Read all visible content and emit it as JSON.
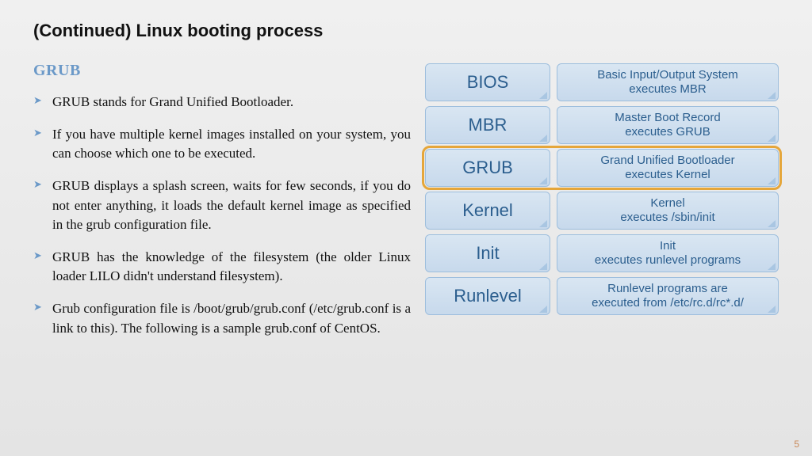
{
  "title": "(Continued) Linux booting process",
  "subhead": "GRUB",
  "bullets": [
    "GRUB stands for Grand Unified Bootloader.",
    "If you have multiple kernel images installed on your system, you can choose which one to be executed.",
    "GRUB displays a splash screen, waits for few seconds, if you do not enter anything, it loads the default kernel image as specified in the grub configuration file.",
    "GRUB has the knowledge of the filesystem (the older Linux loader LILO didn't understand filesystem).",
    "Grub configuration file is /boot/grub/grub.conf (/etc/grub.conf is a link to this). The following is a sample grub.conf of CentOS."
  ],
  "stages": [
    {
      "label": "BIOS",
      "desc": "Basic Input/Output System\nexecutes MBR",
      "highlight": false
    },
    {
      "label": "MBR",
      "desc": "Master Boot Record\nexecutes GRUB",
      "highlight": false
    },
    {
      "label": "GRUB",
      "desc": "Grand Unified Bootloader\nexecutes Kernel",
      "highlight": true
    },
    {
      "label": "Kernel",
      "desc": "Kernel\nexecutes /sbin/init",
      "highlight": false
    },
    {
      "label": "Init",
      "desc": "Init\nexecutes runlevel programs",
      "highlight": false
    },
    {
      "label": "Runlevel",
      "desc": "Runlevel programs are\nexecuted from /etc/rc.d/rc*.d/",
      "highlight": false
    }
  ],
  "page_number": "5"
}
